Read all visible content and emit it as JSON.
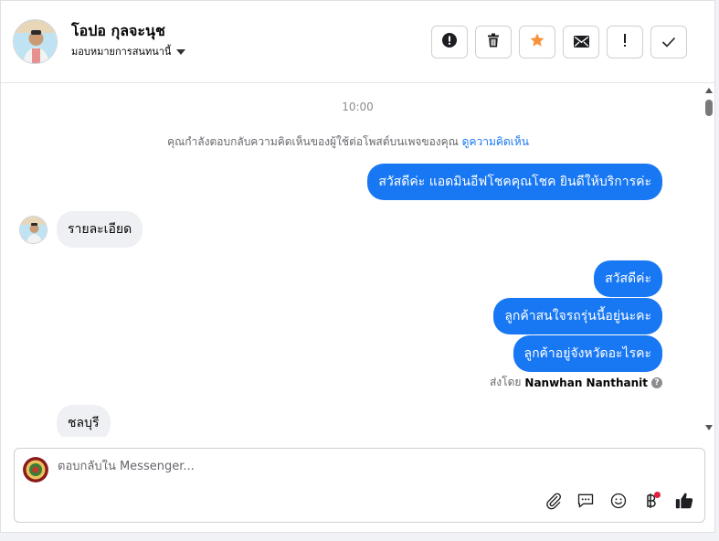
{
  "header": {
    "contact_name": "โอปอ กุลจะนุช",
    "assign_label": "มอบหมายการสนทนานี้"
  },
  "toolbar": {
    "buttons": [
      {
        "name": "mark-spam",
        "icon": "exclamation-circle-icon"
      },
      {
        "name": "delete",
        "icon": "trash-icon"
      },
      {
        "name": "star",
        "icon": "star-icon",
        "color": "#f7923b"
      },
      {
        "name": "mark-unread",
        "icon": "envelope-icon"
      },
      {
        "name": "follow-up",
        "icon": "exclamation-icon"
      },
      {
        "name": "mark-done",
        "icon": "check-icon"
      }
    ]
  },
  "chat": {
    "timestamp": "10:00",
    "system_message": "คุณกำลังตอบกลับความคิดเห็นของผู้ใช้ต่อโพสต์บนเพจของคุณ",
    "system_link": "ดูความคิดเห็น",
    "messages": [
      {
        "direction": "out",
        "text": "สวัสดีค่ะ แอดมินอีฟโชคคุณโชค ยินดีให้บริการค่ะ"
      },
      {
        "direction": "in",
        "text": "รายละเอียด"
      },
      {
        "direction": "out",
        "text": "สวัสดีค่ะ"
      },
      {
        "direction": "out",
        "text": "ลูกค้าสนใจรถรุ่นนี้อยู่นะคะ"
      },
      {
        "direction": "out",
        "text": "ลูกค้าอยู่จังหวัดอะไรคะ"
      },
      {
        "direction": "in",
        "text": "ชลบุรี"
      }
    ],
    "sent_by_label": "ส่งโดย",
    "sent_by_name": "Nanwhan Nanthanit"
  },
  "composer": {
    "placeholder": "ตอบกลับใน Messenger..."
  },
  "colors": {
    "accent": "#1877f2",
    "incoming_bubble": "#eef0f3",
    "star": "#f7923b",
    "notification_dot": "#e41e3f"
  }
}
